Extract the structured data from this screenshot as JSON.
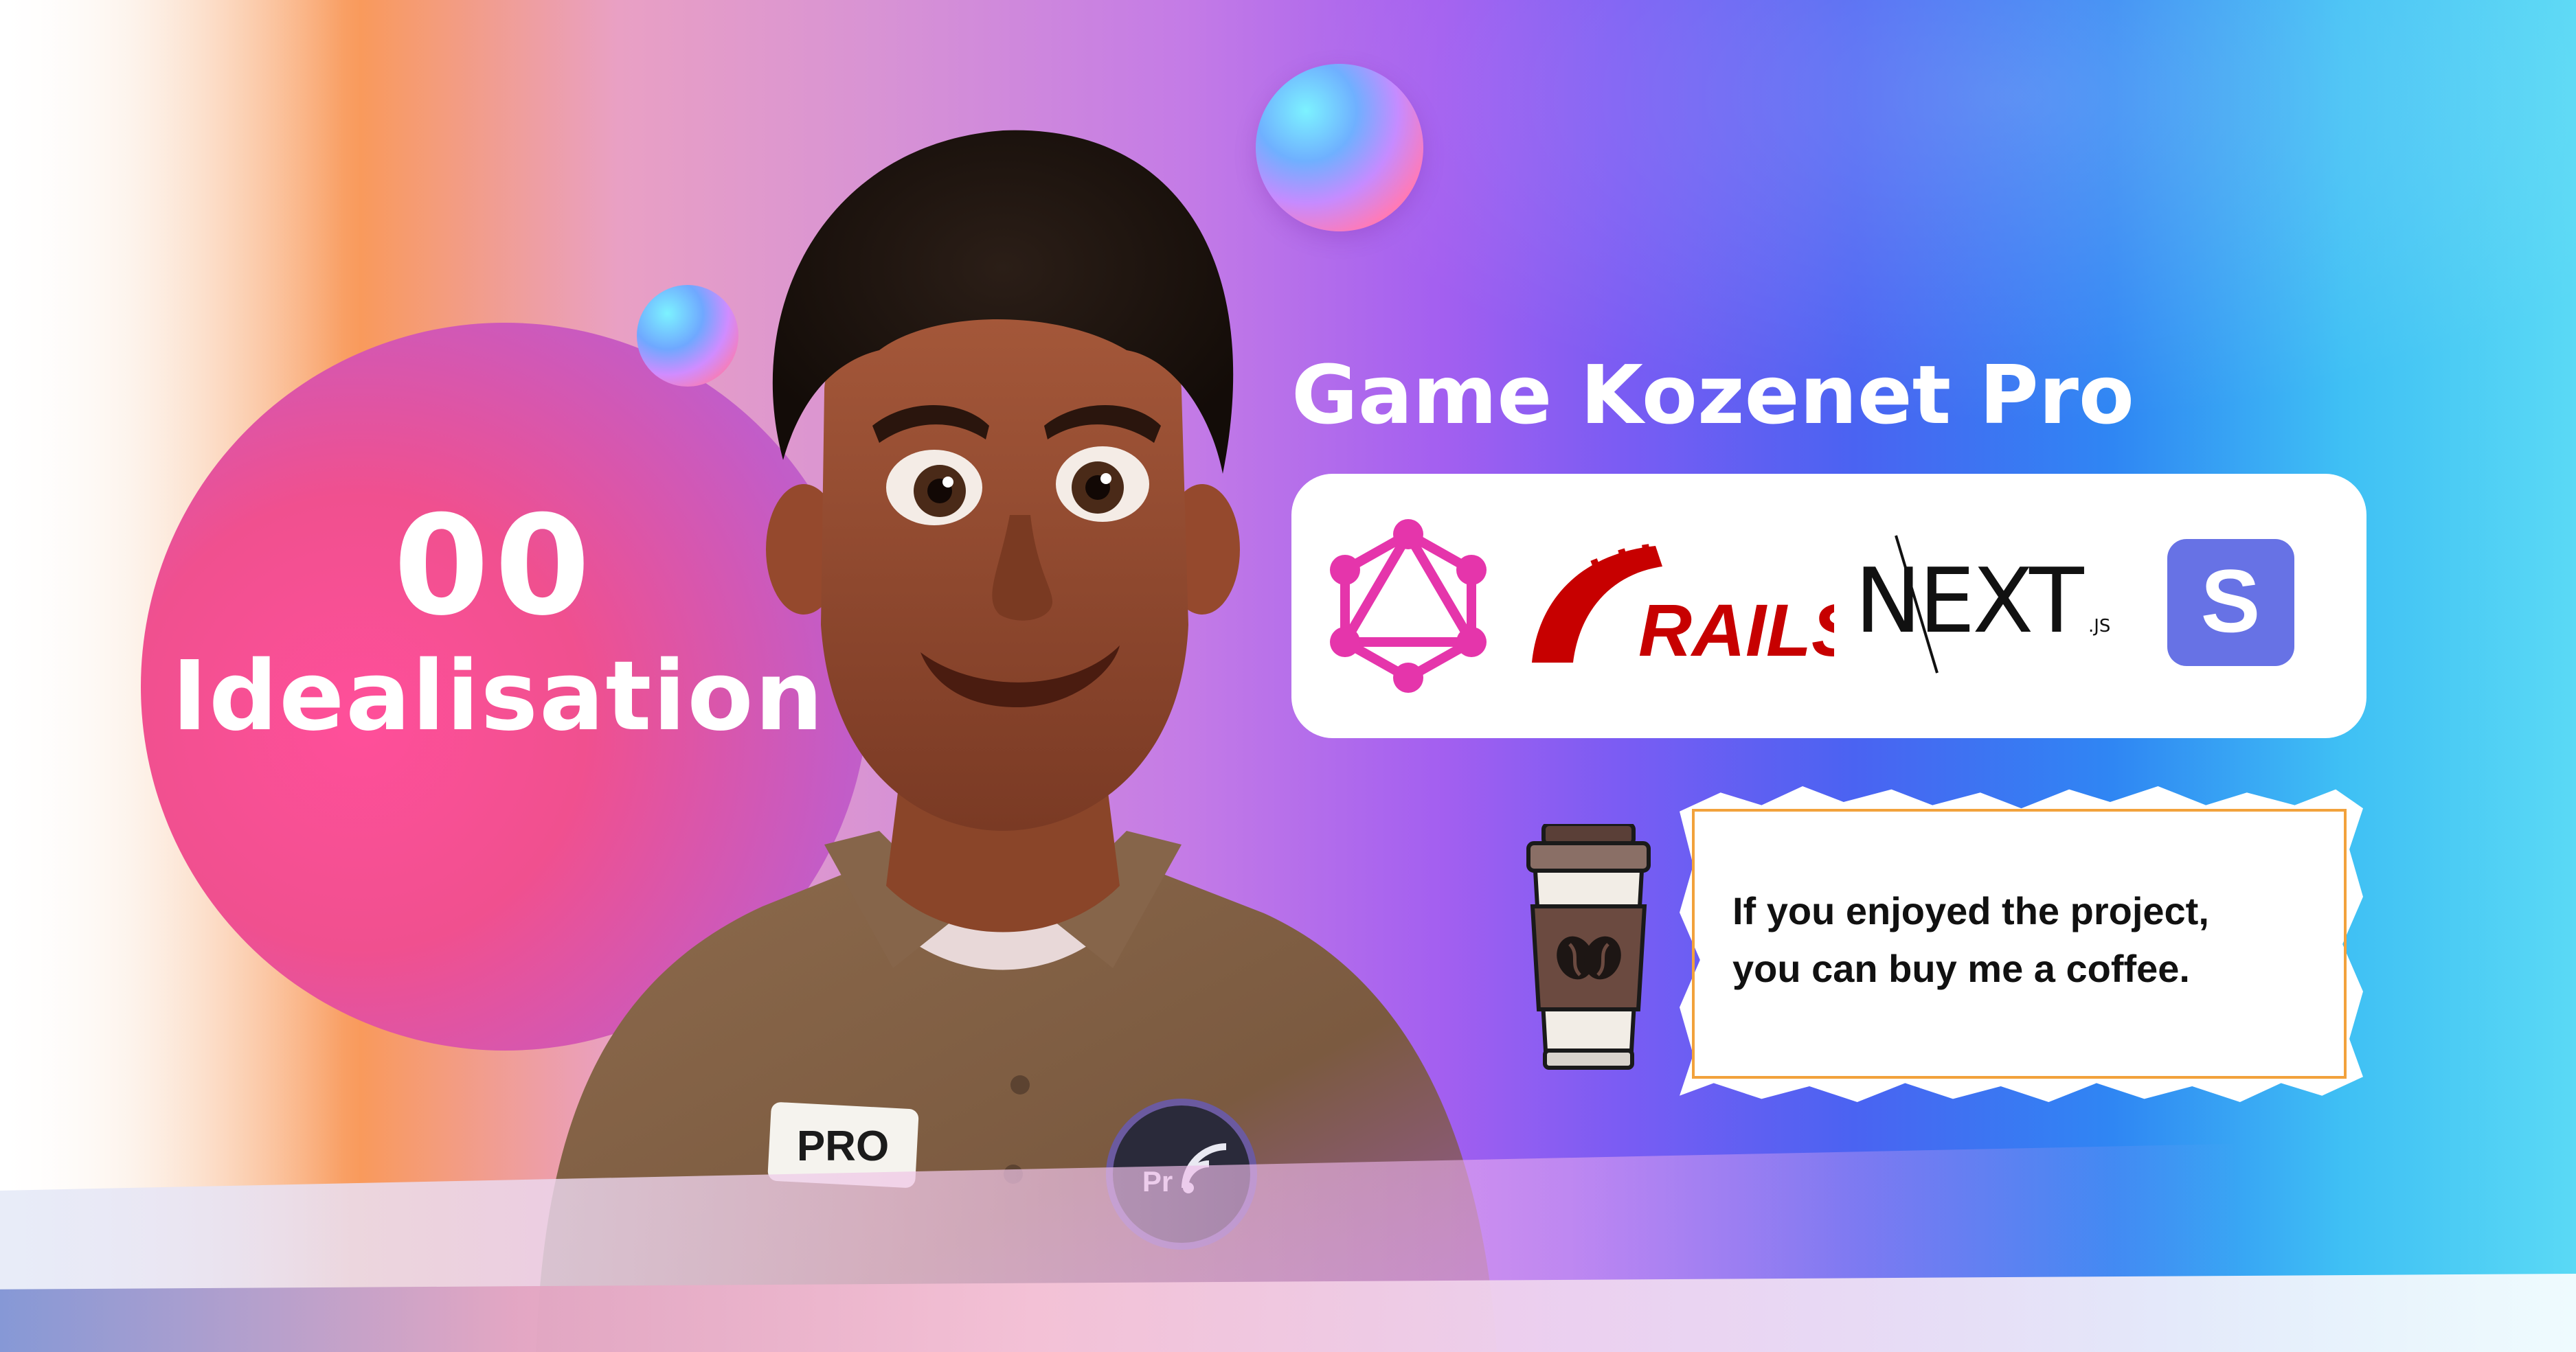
{
  "episode": {
    "number": "00",
    "name": "Idealisation"
  },
  "title": "Game Kozenet Pro",
  "tech_stack": [
    {
      "name": "graphql",
      "icon": "graphql-icon",
      "color": "#e535ab"
    },
    {
      "name": "rails",
      "label": "RAILS",
      "icon": "rails-icon",
      "color": "#c70000"
    },
    {
      "name": "nextjs",
      "label": "NEXT",
      "suffix": ".JS",
      "icon": "nextjs-icon",
      "color": "#111111"
    },
    {
      "name": "stripe",
      "label": "S",
      "icon": "stripe-icon",
      "color": "#6772e5"
    }
  ],
  "coffee": {
    "icon": "coffee-cup-icon",
    "line1": "If you enjoyed the project,",
    "line2": "you can buy me a coffee."
  },
  "character": {
    "badge_text": "PRO",
    "pin_text": "Pr"
  },
  "colors": {
    "accent_pink": "#f0508f",
    "accent_blue": "#2f86f3",
    "note_border": "#f2a23c"
  }
}
